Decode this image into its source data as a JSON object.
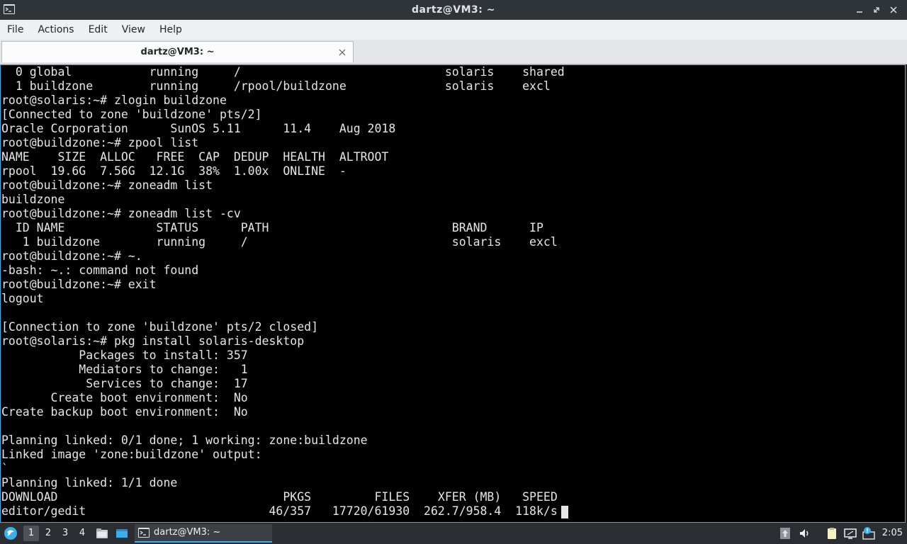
{
  "window": {
    "title": "dartz@VM3: ~"
  },
  "menubar": {
    "items": [
      "File",
      "Actions",
      "Edit",
      "View",
      "Help"
    ]
  },
  "tab": {
    "label": "dartz@VM3: ~"
  },
  "terminal": {
    "lines": [
      "  0 global           running     /                             solaris    shared",
      "  1 buildzone        running     /rpool/buildzone              solaris    excl",
      "root@solaris:~# zlogin buildzone",
      "[Connected to zone 'buildzone' pts/2]",
      "Oracle Corporation      SunOS 5.11      11.4    Aug 2018",
      "root@buildzone:~# zpool list",
      "NAME    SIZE  ALLOC   FREE  CAP  DEDUP  HEALTH  ALTROOT",
      "rpool  19.6G  7.56G  12.1G  38%  1.00x  ONLINE  -",
      "root@buildzone:~# zoneadm list",
      "buildzone",
      "root@buildzone:~# zoneadm list -cv",
      "  ID NAME             STATUS      PATH                          BRAND      IP",
      "   1 buildzone        running     /                             solaris    excl",
      "root@buildzone:~# ~.",
      "-bash: ~.: command not found",
      "root@buildzone:~# exit",
      "logout",
      "",
      "[Connection to zone 'buildzone' pts/2 closed]",
      "root@solaris:~# pkg install solaris-desktop",
      "           Packages to install: 357",
      "           Mediators to change:   1",
      "            Services to change:  17",
      "       Create boot environment:  No",
      "Create backup boot environment:  No",
      "",
      "Planning linked: 0/1 done; 1 working: zone:buildzone",
      "Linked image 'zone:buildzone' output:",
      "`",
      "Planning linked: 1/1 done",
      "DOWNLOAD                                PKGS         FILES    XFER (MB)   SPEED",
      "editor/gedit                          46/357   17720/61930  262.7/958.4  118k/s"
    ]
  },
  "taskbar": {
    "desktops": [
      "1",
      "2",
      "3",
      "4"
    ],
    "active_desktop": "1",
    "task_label": "dartz@VM3: ~",
    "clock": "2:05",
    "icons": [
      "start-menu-icon",
      "file-manager-icon",
      "show-desktop-icon",
      "terminal-icon",
      "updates-icon",
      "volume-icon",
      "clipboard-icon",
      "network-icon",
      "notification-icon"
    ]
  },
  "colors": {
    "accent": "#3daee9",
    "terminal_bg": "#000000",
    "terminal_fg": "#e6e6e6"
  }
}
